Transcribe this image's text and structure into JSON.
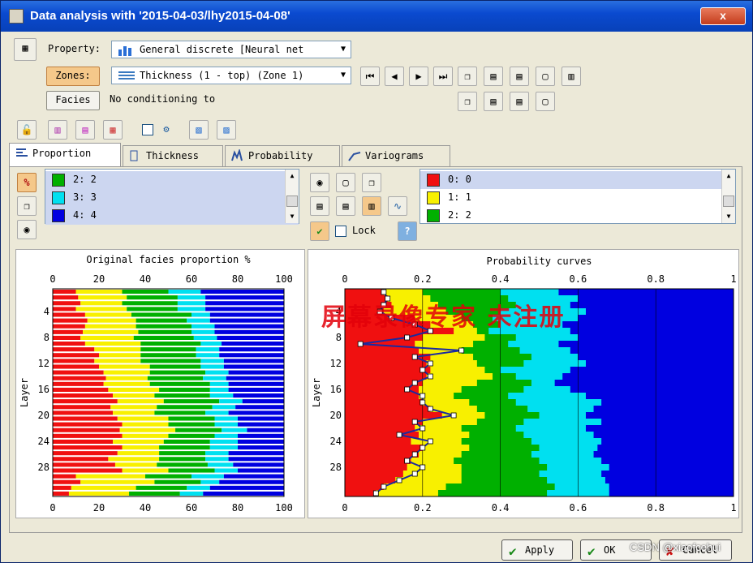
{
  "window": {
    "title": "Data analysis with '2015-04-03/lhy2015-04-08'",
    "close": "x"
  },
  "property": {
    "label": "Property:",
    "value": "General discrete [Neural net"
  },
  "zones": {
    "label": "Zones:",
    "value": "Thickness (1 - top) (Zone 1)"
  },
  "facies": {
    "label": "Facies",
    "text": "No conditioning to"
  },
  "tabs": [
    {
      "label": "Proportion"
    },
    {
      "label": "Thickness"
    },
    {
      "label": "Probability"
    },
    {
      "label": "Variograms"
    }
  ],
  "left_list": [
    {
      "label": "2: 2",
      "color": "#00b000"
    },
    {
      "label": "3: 3",
      "color": "#00e0f0"
    },
    {
      "label": "4: 4",
      "color": "#0000e0"
    }
  ],
  "right_list": [
    {
      "label": "0: 0",
      "color": "#f01010"
    },
    {
      "label": "1: 1",
      "color": "#f8f000"
    },
    {
      "label": "2: 2",
      "color": "#00b000"
    }
  ],
  "lock": {
    "label": "Lock"
  },
  "help": "?",
  "watermark": "屏幕录像专家 未注册",
  "colors": {
    "c0": "#f01010",
    "c1": "#f8f000",
    "c2": "#00b000",
    "c3": "#00e0f0",
    "c4": "#0000e0"
  },
  "chart_data": [
    {
      "type": "bar",
      "title": "Original facies proportion %",
      "xlim": [
        0,
        100
      ],
      "xticks": [
        "0",
        "20",
        "40",
        "60",
        "80",
        "100"
      ],
      "ylabel": "Layer",
      "yticks": [
        "4",
        "8",
        "12",
        "16",
        "20",
        "24",
        "28"
      ],
      "orientation": "horizontal-stacked",
      "series": [
        {
          "facies": "0",
          "values": [
            10,
            11,
            12,
            10,
            14,
            15,
            14,
            13,
            12,
            14,
            18,
            20,
            18,
            20,
            22,
            23,
            22,
            24,
            26,
            28,
            25,
            26,
            28,
            30,
            29,
            30,
            26,
            30,
            28,
            24,
            27,
            30,
            10,
            12,
            8,
            7
          ]
        },
        {
          "facies": "1",
          "values": [
            20,
            21,
            18,
            22,
            20,
            21,
            22,
            24,
            23,
            24,
            20,
            18,
            20,
            22,
            20,
            18,
            20,
            22,
            18,
            20,
            20,
            18,
            22,
            20,
            24,
            20,
            22,
            16,
            18,
            22,
            18,
            20,
            30,
            32,
            28,
            26
          ]
        },
        {
          "facies": "2",
          "values": [
            20,
            22,
            24,
            22,
            26,
            22,
            24,
            23,
            26,
            26,
            24,
            24,
            26,
            22,
            24,
            24,
            26,
            22,
            24,
            24,
            24,
            22,
            20,
            20,
            20,
            20,
            20,
            22,
            20,
            20,
            22,
            20,
            20,
            20,
            22,
            22
          ]
        },
        {
          "facies": "3",
          "values": [
            14,
            12,
            12,
            12,
            8,
            10,
            10,
            10,
            10,
            9,
            10,
            10,
            10,
            10,
            10,
            10,
            8,
            8,
            10,
            10,
            10,
            10,
            10,
            10,
            11,
            10,
            12,
            12,
            10,
            10,
            11,
            10,
            14,
            8,
            10,
            10
          ]
        },
        {
          "facies": "4",
          "values": [
            36,
            34,
            34,
            34,
            32,
            32,
            30,
            30,
            29,
            27,
            28,
            28,
            26,
            26,
            24,
            25,
            24,
            24,
            22,
            18,
            21,
            24,
            20,
            20,
            16,
            20,
            20,
            20,
            24,
            24,
            22,
            20,
            26,
            28,
            32,
            35
          ]
        }
      ]
    },
    {
      "type": "area",
      "title": "Probability curves",
      "xlim": [
        0,
        1
      ],
      "xticks": [
        "0",
        "0.2",
        "0.4",
        "0.6",
        "0.8",
        "1"
      ],
      "ylabel": "Layer",
      "yticks": [
        "4",
        "8",
        "12",
        "16",
        "20",
        "24",
        "28"
      ],
      "layers": 32,
      "cumulative": [
        [
          0.1,
          0.11,
          0.12,
          0.1,
          0.18,
          0.22,
          0.28,
          0.2,
          0.18,
          0.19,
          0.22,
          0.21,
          0.22,
          0.21,
          0.2,
          0.19,
          0.19,
          0.2,
          0.22,
          0.25,
          0.2,
          0.18,
          0.19,
          0.17,
          0.2,
          0.19,
          0.17,
          0.16,
          0.15,
          0.13,
          0.1,
          0.08
        ],
        [
          0.2,
          0.22,
          0.24,
          0.26,
          0.3,
          0.33,
          0.34,
          0.36,
          0.33,
          0.3,
          0.33,
          0.34,
          0.36,
          0.38,
          0.34,
          0.3,
          0.28,
          0.32,
          0.34,
          0.36,
          0.34,
          0.3,
          0.32,
          0.3,
          0.32,
          0.3,
          0.28,
          0.3,
          0.3,
          0.3,
          0.26,
          0.24
        ],
        [
          0.4,
          0.42,
          0.44,
          0.4,
          0.38,
          0.4,
          0.37,
          0.44,
          0.42,
          0.45,
          0.48,
          0.46,
          0.4,
          0.44,
          0.48,
          0.46,
          0.42,
          0.44,
          0.47,
          0.5,
          0.46,
          0.44,
          0.46,
          0.48,
          0.5,
          0.48,
          0.5,
          0.52,
          0.5,
          0.52,
          0.54,
          0.52
        ],
        [
          0.55,
          0.6,
          0.58,
          0.62,
          0.6,
          0.56,
          0.58,
          0.6,
          0.55,
          0.58,
          0.6,
          0.62,
          0.58,
          0.56,
          0.54,
          0.58,
          0.62,
          0.66,
          0.64,
          0.62,
          0.66,
          0.62,
          0.64,
          0.66,
          0.65,
          0.64,
          0.66,
          0.68,
          0.66,
          0.67,
          0.68,
          0.68
        ],
        [
          0.7,
          0.72,
          0.74,
          0.76,
          0.77,
          0.75,
          0.73,
          0.74,
          0.72,
          0.74,
          0.72,
          0.7,
          0.71,
          0.72,
          0.74,
          0.75,
          0.72,
          0.7,
          0.74,
          0.76,
          0.74,
          0.72,
          0.7,
          0.74,
          0.72,
          0.7,
          0.71,
          0.68,
          0.7,
          0.69,
          0.68,
          0.68
        ]
      ],
      "blue_line": [
        0.1,
        0.11,
        0.1,
        0.09,
        0.12,
        0.18,
        0.22,
        0.16,
        0.04,
        0.3,
        0.18,
        0.22,
        0.2,
        0.22,
        0.18,
        0.16,
        0.2,
        0.2,
        0.22,
        0.28,
        0.18,
        0.2,
        0.14,
        0.22,
        0.2,
        0.18,
        0.16,
        0.2,
        0.18,
        0.14,
        0.1,
        0.08
      ]
    }
  ],
  "footer": {
    "apply": "Apply",
    "ok": "OK",
    "cancel": "Cancel",
    "csdn": "CSDN @xiaofcehui"
  }
}
